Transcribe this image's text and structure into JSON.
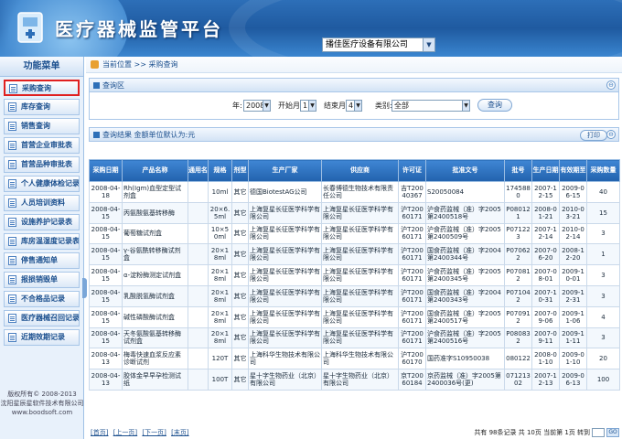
{
  "header": {
    "title": "医疗器械监管平台",
    "company_select": "播佳医疗设备有限公司"
  },
  "sidebar": {
    "title": "功能菜单",
    "items": [
      {
        "label": "采购查询",
        "active": true
      },
      {
        "label": "库存查询"
      },
      {
        "label": "销售查询"
      },
      {
        "label": "首营企业审批表"
      },
      {
        "label": "首营品种审批表"
      },
      {
        "label": "个人健康体检记录"
      },
      {
        "label": "人员培训资料"
      },
      {
        "label": "设施养护记录表"
      },
      {
        "label": "库房温湿度记录表"
      },
      {
        "label": "停售通知单"
      },
      {
        "label": "报损销毁单"
      },
      {
        "label": "不合格品记录"
      },
      {
        "label": "医疗器械召回记录"
      },
      {
        "label": "近期效期记录"
      }
    ],
    "footer_line1": "版权所有© 2008-2013",
    "footer_line2": "沈阳星辰星软件技术有限公司",
    "footer_line3": "www.boodsoft.com"
  },
  "breadcrumb": {
    "label": "当前位置 >> 采购查询"
  },
  "query_panel": {
    "title": "查询区",
    "toggle": "⊖",
    "year_label": "年:",
    "year_value": "2008",
    "start_month_label": "开始月:",
    "start_month_value": "1",
    "end_month_label": "结束月:",
    "end_month_value": "4",
    "category_label": "类别:",
    "category_value": "全部",
    "query_button": "查询"
  },
  "results_panel": {
    "title": "查询结果 金额单位默认为:元",
    "print_button": "打印"
  },
  "table": {
    "columns": [
      "采购日期",
      "产品名称",
      "通用名",
      "规格",
      "剂型",
      "生产厂家",
      "供应商",
      "许可证",
      "批准文号",
      "批号",
      "生产日期",
      "有效期至",
      "采购数量"
    ],
    "rows": [
      [
        "2008-04-18",
        "Rh(Igm)血型定型试剂盒",
        "",
        "10ml",
        "其它",
        "德国BiotestAG公司",
        "长春博德生物技术有限责任公司",
        "吉T20040367",
        "S20050084",
        "1745880",
        "2007-12-15",
        "2009-06-15",
        "40"
      ],
      [
        "2008-04-15",
        "丙氨酸氨基转移酶",
        "",
        "20×6.5ml",
        "其它",
        "上海复星长征医学科学有限公司",
        "上海复星长征医学科学有限公司",
        "沪T20060171",
        "沪食药监械（准）字2005第2400518号",
        "P080121",
        "2008-01-21",
        "2010-03-21",
        "15"
      ],
      [
        "2008-04-15",
        "葡萄糖试剂盒",
        "",
        "10×50ml",
        "其它",
        "上海复星长征医学科学有限公司",
        "上海复星长征医学科学有限公司",
        "沪T20060171",
        "沪食药监械（准）字2005第2400509号",
        "P071223",
        "2007-12-14",
        "2010-02-14",
        "3"
      ],
      [
        "2008-04-15",
        "γ-谷氨酰转移酶试剂盒",
        "",
        "20×18ml",
        "其它",
        "上海复星长征医学科学有限公司",
        "上海复星长征医学科学有限公司",
        "沪T20060171",
        "国食药监械（准）字2004第2400344号",
        "P070622",
        "2007-06-20",
        "2008-12-20",
        "1"
      ],
      [
        "2008-04-15",
        "α-淀粉酶测定试剂盒",
        "",
        "20×18ml",
        "其它",
        "上海复星长征医学科学有限公司",
        "上海复星长征医学科学有限公司",
        "沪T20060171",
        "沪食药监械（准）字2005第2400345号",
        "P070812",
        "2007-08-01",
        "2009-10-01",
        "3"
      ],
      [
        "2008-04-15",
        "乳酸脱氢酶试剂盒",
        "",
        "20×18ml",
        "其它",
        "上海复星长征医学科学有限公司",
        "上海复星长征医学科学有限公司",
        "沪T20060171",
        "国食药监械（准）字2004第2400343号",
        "P071042",
        "2007-10-31",
        "2009-12-31",
        "3"
      ],
      [
        "2008-04-15",
        "碱性磷酸酶试剂盒",
        "",
        "20×18ml",
        "其它",
        "上海复星长征医学科学有限公司",
        "上海复星长征医学科学有限公司",
        "沪T20060171",
        "国食药监械（准）字2005第2400517号",
        "P070912",
        "2007-09-06",
        "2009-11-06",
        "4"
      ],
      [
        "2008-04-15",
        "天冬氨酸氨基转移酶试剂盒",
        "",
        "20×18ml",
        "其它",
        "上海复星长征医学科学有限公司",
        "上海复星长征医学科学有限公司",
        "沪T20060171",
        "沪食药监械（准）字2005第2400516号",
        "P080832",
        "2007-09-11",
        "2009-11-11",
        "3"
      ],
      [
        "2008-04-13",
        "梅毒快速血浆反应素诊断试剂",
        "",
        "120T",
        "其它",
        "上海科华生物技术有限公司",
        "上海科华生物技术有限公司",
        "沪T20060170",
        "国药准字S10950038",
        "080122",
        "2008-01-10",
        "2009-01-10",
        "20"
      ],
      [
        "2008-04-13",
        "胶体金早早孕检测试纸",
        "",
        "100T",
        "其它",
        "星十字生物药业（北京）有限公司",
        "星十字生物药业（北京）有限公司",
        "京T20060184",
        "京药监械（准）字2005第2400036号(更)",
        "07121302",
        "2007-12-13",
        "2009-06-13",
        "100"
      ]
    ]
  },
  "pager": {
    "first": "[首页]",
    "prev": "[上一页]",
    "next": "[下一页]",
    "last": "[末页]",
    "info": "共有 98条记录 共 10页 当前第 1页 转到",
    "go": "GO"
  }
}
